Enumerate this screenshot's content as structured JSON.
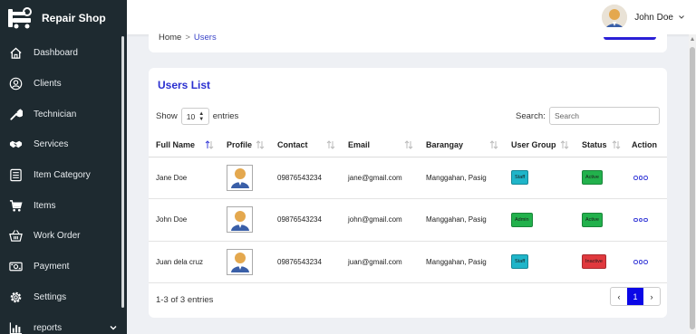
{
  "app": {
    "name": "Repair Shop"
  },
  "sidebar": {
    "items": [
      {
        "label": "Dashboard",
        "icon": "home-icon"
      },
      {
        "label": "Clients",
        "icon": "user-circle-icon"
      },
      {
        "label": "Technician",
        "icon": "wrench-icon"
      },
      {
        "label": "Services",
        "icon": "handshake-icon"
      },
      {
        "label": "Item Category",
        "icon": "list-icon"
      },
      {
        "label": "Items",
        "icon": "cart-icon"
      },
      {
        "label": "Work Order",
        "icon": "basket-icon"
      },
      {
        "label": "Payment",
        "icon": "money-icon"
      },
      {
        "label": "Settings",
        "icon": "gear-icon"
      },
      {
        "label": "reports",
        "icon": "bar-chart-icon"
      }
    ]
  },
  "topbar": {
    "user_name": "John Doe"
  },
  "breadcrumb": {
    "home": "Home",
    "separator": ">",
    "current": "Users"
  },
  "card": {
    "title": "Users List",
    "show_label": "Show",
    "show_value": "10",
    "entries_label": "entries",
    "search_label": "Search:",
    "search_placeholder": "Search"
  },
  "table": {
    "headers": [
      "Full Name",
      "Profile",
      "Contact",
      "Email",
      "Barangay",
      "User Group",
      "Status",
      "Action"
    ],
    "rows": [
      {
        "name": "Jane Doe",
        "contact": "09876543234",
        "email": "jane@gmail.com",
        "barangay": "Manggahan, Pasig",
        "group": "Staff",
        "group_color": "#1fb5c9",
        "status": "Active",
        "status_color": "#22b14c"
      },
      {
        "name": "John Doe",
        "contact": "09876543234",
        "email": "john@gmail.com",
        "barangay": "Manggahan, Pasig",
        "group": "Admin",
        "group_color": "#22b14c",
        "status": "Active",
        "status_color": "#22b14c"
      },
      {
        "name": "Juan dela cruz",
        "contact": "09876543234",
        "email": "juan@gmail.com",
        "barangay": "Manggahan, Pasig",
        "group": "Staff",
        "group_color": "#1fb5c9",
        "status": "Inactive",
        "status_color": "#e0393e"
      }
    ]
  },
  "footer": {
    "entries_text": "1-3 of 3 entries",
    "page": "1",
    "prev": "‹",
    "next": "›"
  },
  "colors": {
    "sidebar": "#1e2a30",
    "accent": "#2a2fd0",
    "pager_active": "#0b07e6"
  }
}
